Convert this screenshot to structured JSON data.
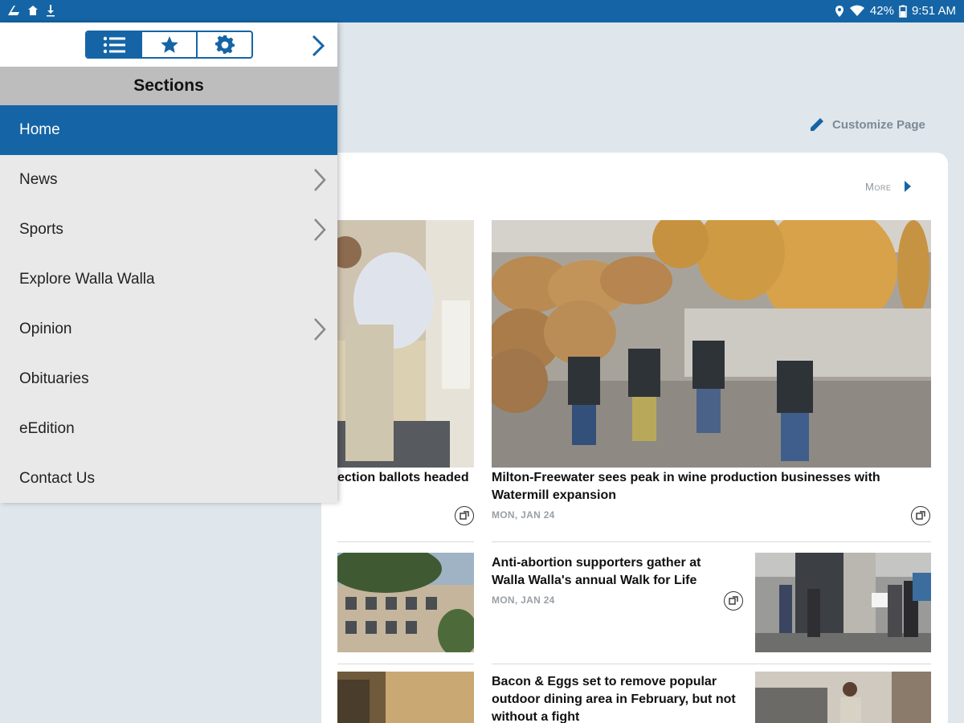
{
  "status_bar": {
    "battery": "42%",
    "time": "9:51 AM"
  },
  "page": {
    "customize_label": "Customize Page",
    "more_label": "More",
    "colors": {
      "brand": "#1565a6",
      "drawer_bg": "#e9e9e9",
      "page_bg": "#dfe6ec"
    }
  },
  "articles": [
    {
      "headline": "ection ballots headed",
      "date": ""
    },
    {
      "headline": "Milton-Freewater sees peak in wine production businesses with Watermill expansion",
      "date": "MON, JAN 24"
    },
    {
      "headline": "Anti-abortion supporters gather at Walla Walla's annual Walk for Life",
      "date": "MON, JAN 24"
    },
    {
      "headline": "Bacon & Eggs set to remove popular outdoor dining area in February, but not without a fight",
      "date": ""
    }
  ],
  "drawer": {
    "tabs": [
      {
        "icon": "list-icon",
        "active": true
      },
      {
        "icon": "star-icon",
        "active": false
      },
      {
        "icon": "gear-icon",
        "active": false
      }
    ],
    "title": "Sections",
    "items": [
      {
        "label": "Home",
        "active": true,
        "has_children": false
      },
      {
        "label": "News",
        "active": false,
        "has_children": true
      },
      {
        "label": "Sports",
        "active": false,
        "has_children": true
      },
      {
        "label": "Explore Walla Walla",
        "active": false,
        "has_children": false
      },
      {
        "label": "Opinion",
        "active": false,
        "has_children": true
      },
      {
        "label": "Obituaries",
        "active": false,
        "has_children": false
      },
      {
        "label": "eEdition",
        "active": false,
        "has_children": false
      },
      {
        "label": "Contact Us",
        "active": false,
        "has_children": false
      }
    ]
  }
}
